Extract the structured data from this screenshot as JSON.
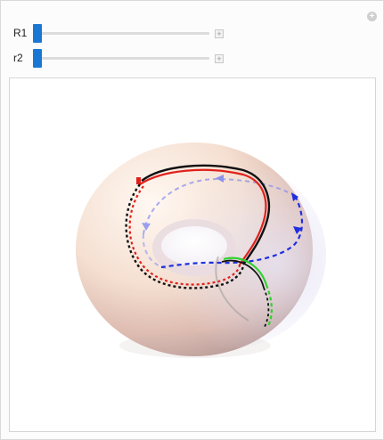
{
  "controls": {
    "sliders": [
      {
        "label": "R1",
        "value": 0
      },
      {
        "label": "r2",
        "value": 0
      }
    ]
  },
  "colors": {
    "slider_thumb": "#1a78d4",
    "curve_red": "#e0211b",
    "curve_black": "#111111",
    "curve_blue": "#1f2ee0",
    "curve_green": "#2fd12f"
  },
  "icons": {
    "corner": "plus-circle-icon",
    "slider_increment": "plus-icon"
  }
}
